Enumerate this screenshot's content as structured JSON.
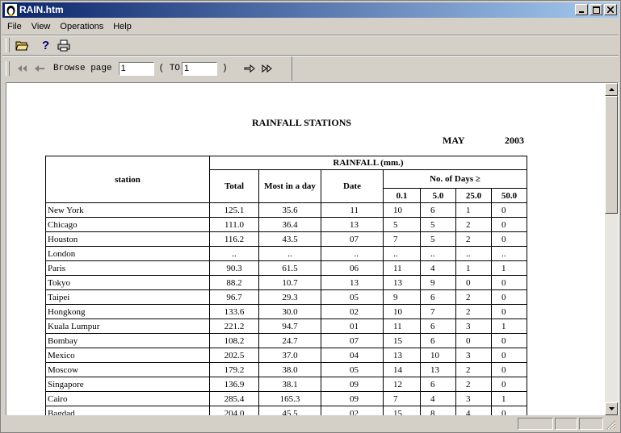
{
  "window": {
    "title": "RAIN.htm"
  },
  "menu": [
    "File",
    "View",
    "Operations",
    "Help"
  ],
  "navbar": {
    "browse_label": "Browse page",
    "page_from": "1",
    "to_label": "( TO",
    "page_to": "1",
    "close_paren": ")"
  },
  "document": {
    "title": "RAINFALL STATIONS",
    "month": "MAY",
    "year": "2003",
    "headers": {
      "station": "station",
      "rainfall": "RAINFALL (mm.)",
      "total": "Total",
      "most": "Most in a day",
      "date": "Date",
      "days": "No. of Days ≥",
      "d1": "0.1",
      "d2": "5.0",
      "d3": "25.0",
      "d4": "50.0"
    },
    "rows": [
      [
        "New York",
        "125.1",
        "35.6",
        "11",
        "10",
        "6",
        "1",
        "0"
      ],
      [
        "Chicago",
        "111.0",
        "36.4",
        "13",
        "5",
        "5",
        "2",
        "0"
      ],
      [
        "Houston",
        "116.2",
        "43.5",
        "07",
        "7",
        "5",
        "2",
        "0"
      ],
      [
        "London",
        "..",
        "..",
        "..",
        "..",
        "..",
        "..",
        ".."
      ],
      [
        "Paris",
        "90.3",
        "61.5",
        "06",
        "11",
        "4",
        "1",
        "1"
      ],
      [
        "Tokyo",
        "88.2",
        "10.7",
        "13",
        "13",
        "9",
        "0",
        "0"
      ],
      [
        "Taipei",
        "96.7",
        "29.3",
        "05",
        "9",
        "6",
        "2",
        "0"
      ],
      [
        "Hongkong",
        "133.6",
        "30.0",
        "02",
        "10",
        "7",
        "2",
        "0"
      ],
      [
        "Kuala Lumpur",
        "221.2",
        "94.7",
        "01",
        "11",
        "6",
        "3",
        "1"
      ],
      [
        "Bombay",
        "108.2",
        "24.7",
        "07",
        "15",
        "6",
        "0",
        "0"
      ],
      [
        "Mexico",
        "202.5",
        "37.0",
        "04",
        "13",
        "10",
        "3",
        "0"
      ],
      [
        "Moscow",
        "179.2",
        "38.0",
        "05",
        "14",
        "13",
        "2",
        "0"
      ],
      [
        "Singapore",
        "136.9",
        "38.1",
        "09",
        "12",
        "6",
        "2",
        "0"
      ],
      [
        "Cairo",
        "285.4",
        "165.3",
        "09",
        "7",
        "4",
        "3",
        "1"
      ],
      [
        "Bagdad",
        "204.0",
        "45.5",
        "02",
        "15",
        "8",
        "4",
        "0"
      ]
    ]
  }
}
